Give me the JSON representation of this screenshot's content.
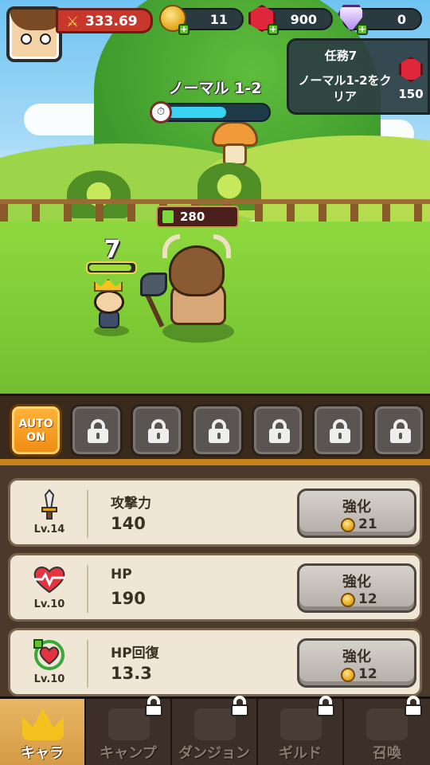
{
  "hud": {
    "power": "333.69",
    "gold": "11",
    "rubies": "900",
    "diamonds": "0",
    "icons": {
      "power": "swords-icon",
      "gold": "gold-coin-icon",
      "ruby": "ruby-icon",
      "diamond": "diamond-icon",
      "plus": "plus-icon"
    }
  },
  "mission": {
    "title": "任務7",
    "description": "ノーマル1-2をクリア",
    "reward": "150"
  },
  "stage": {
    "name": "ノーマル 1-2",
    "timer_fraction": 0.6
  },
  "battle": {
    "enemy_hp": "280",
    "damage": "7",
    "hero_hp_fraction": 0.95
  },
  "skills": {
    "auto_label": "AUTO ON",
    "locked_slots": 6
  },
  "upgrades": [
    {
      "name": "攻撃力",
      "value": "140",
      "level": "Lv.14",
      "button": "強化",
      "cost": "21",
      "icon": "sword-icon"
    },
    {
      "name": "HP",
      "value": "190",
      "level": "Lv.10",
      "button": "強化",
      "cost": "12",
      "icon": "heartbeat-icon"
    },
    {
      "name": "HP回復",
      "value": "13.3",
      "level": "Lv.10",
      "button": "強化",
      "cost": "12",
      "icon": "heart-regen-icon"
    }
  ],
  "nav": [
    {
      "label": "キャラ",
      "active": true,
      "locked": false
    },
    {
      "label": "キャンプ",
      "active": false,
      "locked": true
    },
    {
      "label": "ダンジョン",
      "active": false,
      "locked": true
    },
    {
      "label": "ギルド",
      "active": false,
      "locked": true
    },
    {
      "label": "召喚",
      "active": false,
      "locked": true
    }
  ],
  "colors": {
    "accent_orange": "#f08a12",
    "hp_green": "#9fdc3a",
    "timer_cyan": "#39d3f4",
    "power_red": "#c8372c"
  }
}
